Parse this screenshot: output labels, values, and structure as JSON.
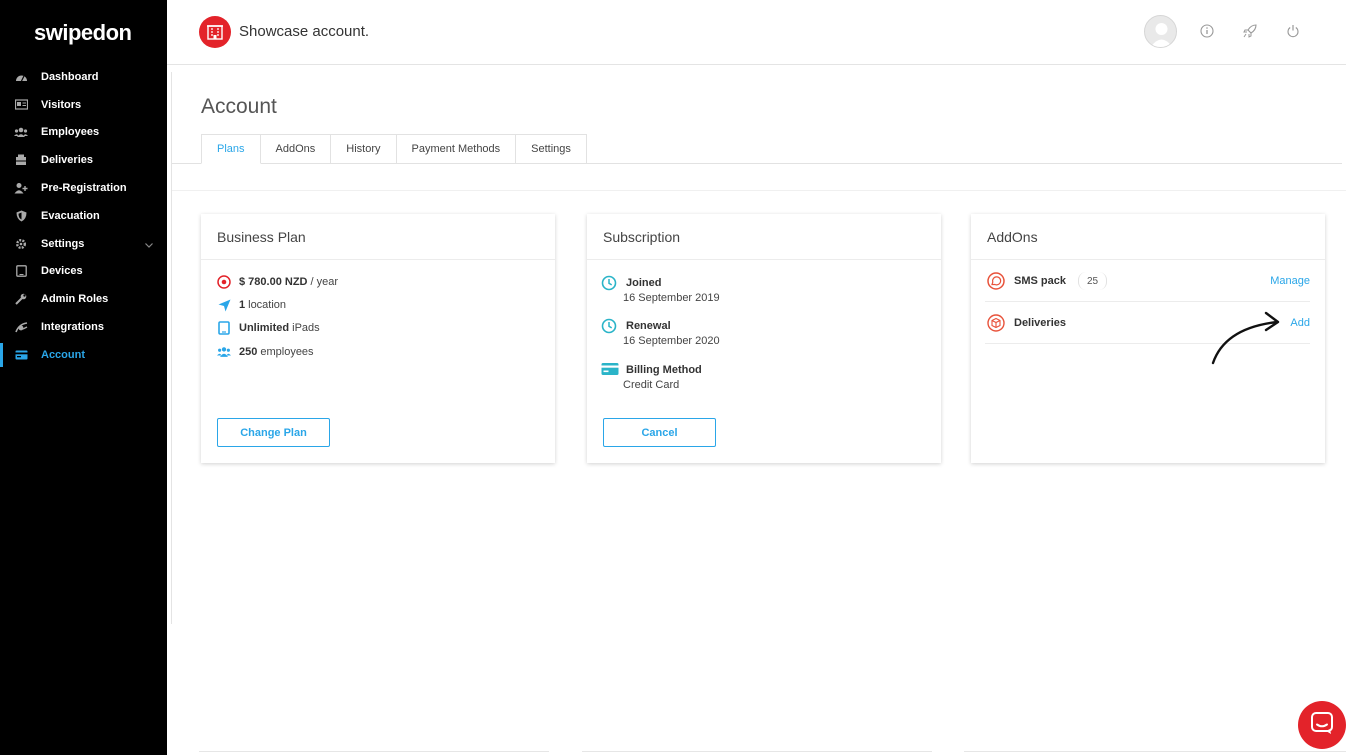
{
  "brand": {
    "logo_text": "swipedon",
    "accent": "#2aa6e8",
    "brand_red": "#e3232a"
  },
  "sidebar": {
    "items": [
      {
        "label": "Dashboard",
        "icon": "dashboard-icon"
      },
      {
        "label": "Visitors",
        "icon": "visitors-icon"
      },
      {
        "label": "Employees",
        "icon": "employees-icon"
      },
      {
        "label": "Deliveries",
        "icon": "deliveries-icon"
      },
      {
        "label": "Pre-Registration",
        "icon": "pre-registration-icon"
      },
      {
        "label": "Evacuation",
        "icon": "shield-icon"
      },
      {
        "label": "Settings",
        "icon": "gear-icon"
      },
      {
        "label": "Devices",
        "icon": "tablet-icon"
      },
      {
        "label": "Admin Roles",
        "icon": "wrench-icon"
      },
      {
        "label": "Integrations",
        "icon": "integrations-icon"
      },
      {
        "label": "Account",
        "icon": "card-icon",
        "active": true
      }
    ]
  },
  "topbar": {
    "account_name": "Showcase account."
  },
  "page": {
    "title": "Account",
    "tabs": [
      {
        "label": "Plans",
        "active": true
      },
      {
        "label": "AddOns"
      },
      {
        "label": "History"
      },
      {
        "label": "Payment Methods"
      },
      {
        "label": "Settings"
      }
    ]
  },
  "plan_card": {
    "title": "Business Plan",
    "price_value": "$ 780.00 NZD",
    "price_suffix": "/  year",
    "locations_value": "1",
    "locations_label": "location",
    "ipads_value": "Unlimited",
    "ipads_label": "iPads",
    "employees_value": "250",
    "employees_label": "employees",
    "button": "Change Plan"
  },
  "subscription_card": {
    "title": "Subscription",
    "joined_label": "Joined",
    "joined_value": "16 September 2019",
    "renewal_label": "Renewal",
    "renewal_value": "16 September 2020",
    "billing_label": "Billing Method",
    "billing_value": "Credit Card",
    "button": "Cancel"
  },
  "addons_card": {
    "title": "AddOns",
    "items": [
      {
        "name": "SMS pack",
        "count": "25",
        "action": "Manage",
        "icon": "sms-icon"
      },
      {
        "name": "Deliveries",
        "action": "Add",
        "icon": "deliveries-box-icon"
      }
    ]
  }
}
